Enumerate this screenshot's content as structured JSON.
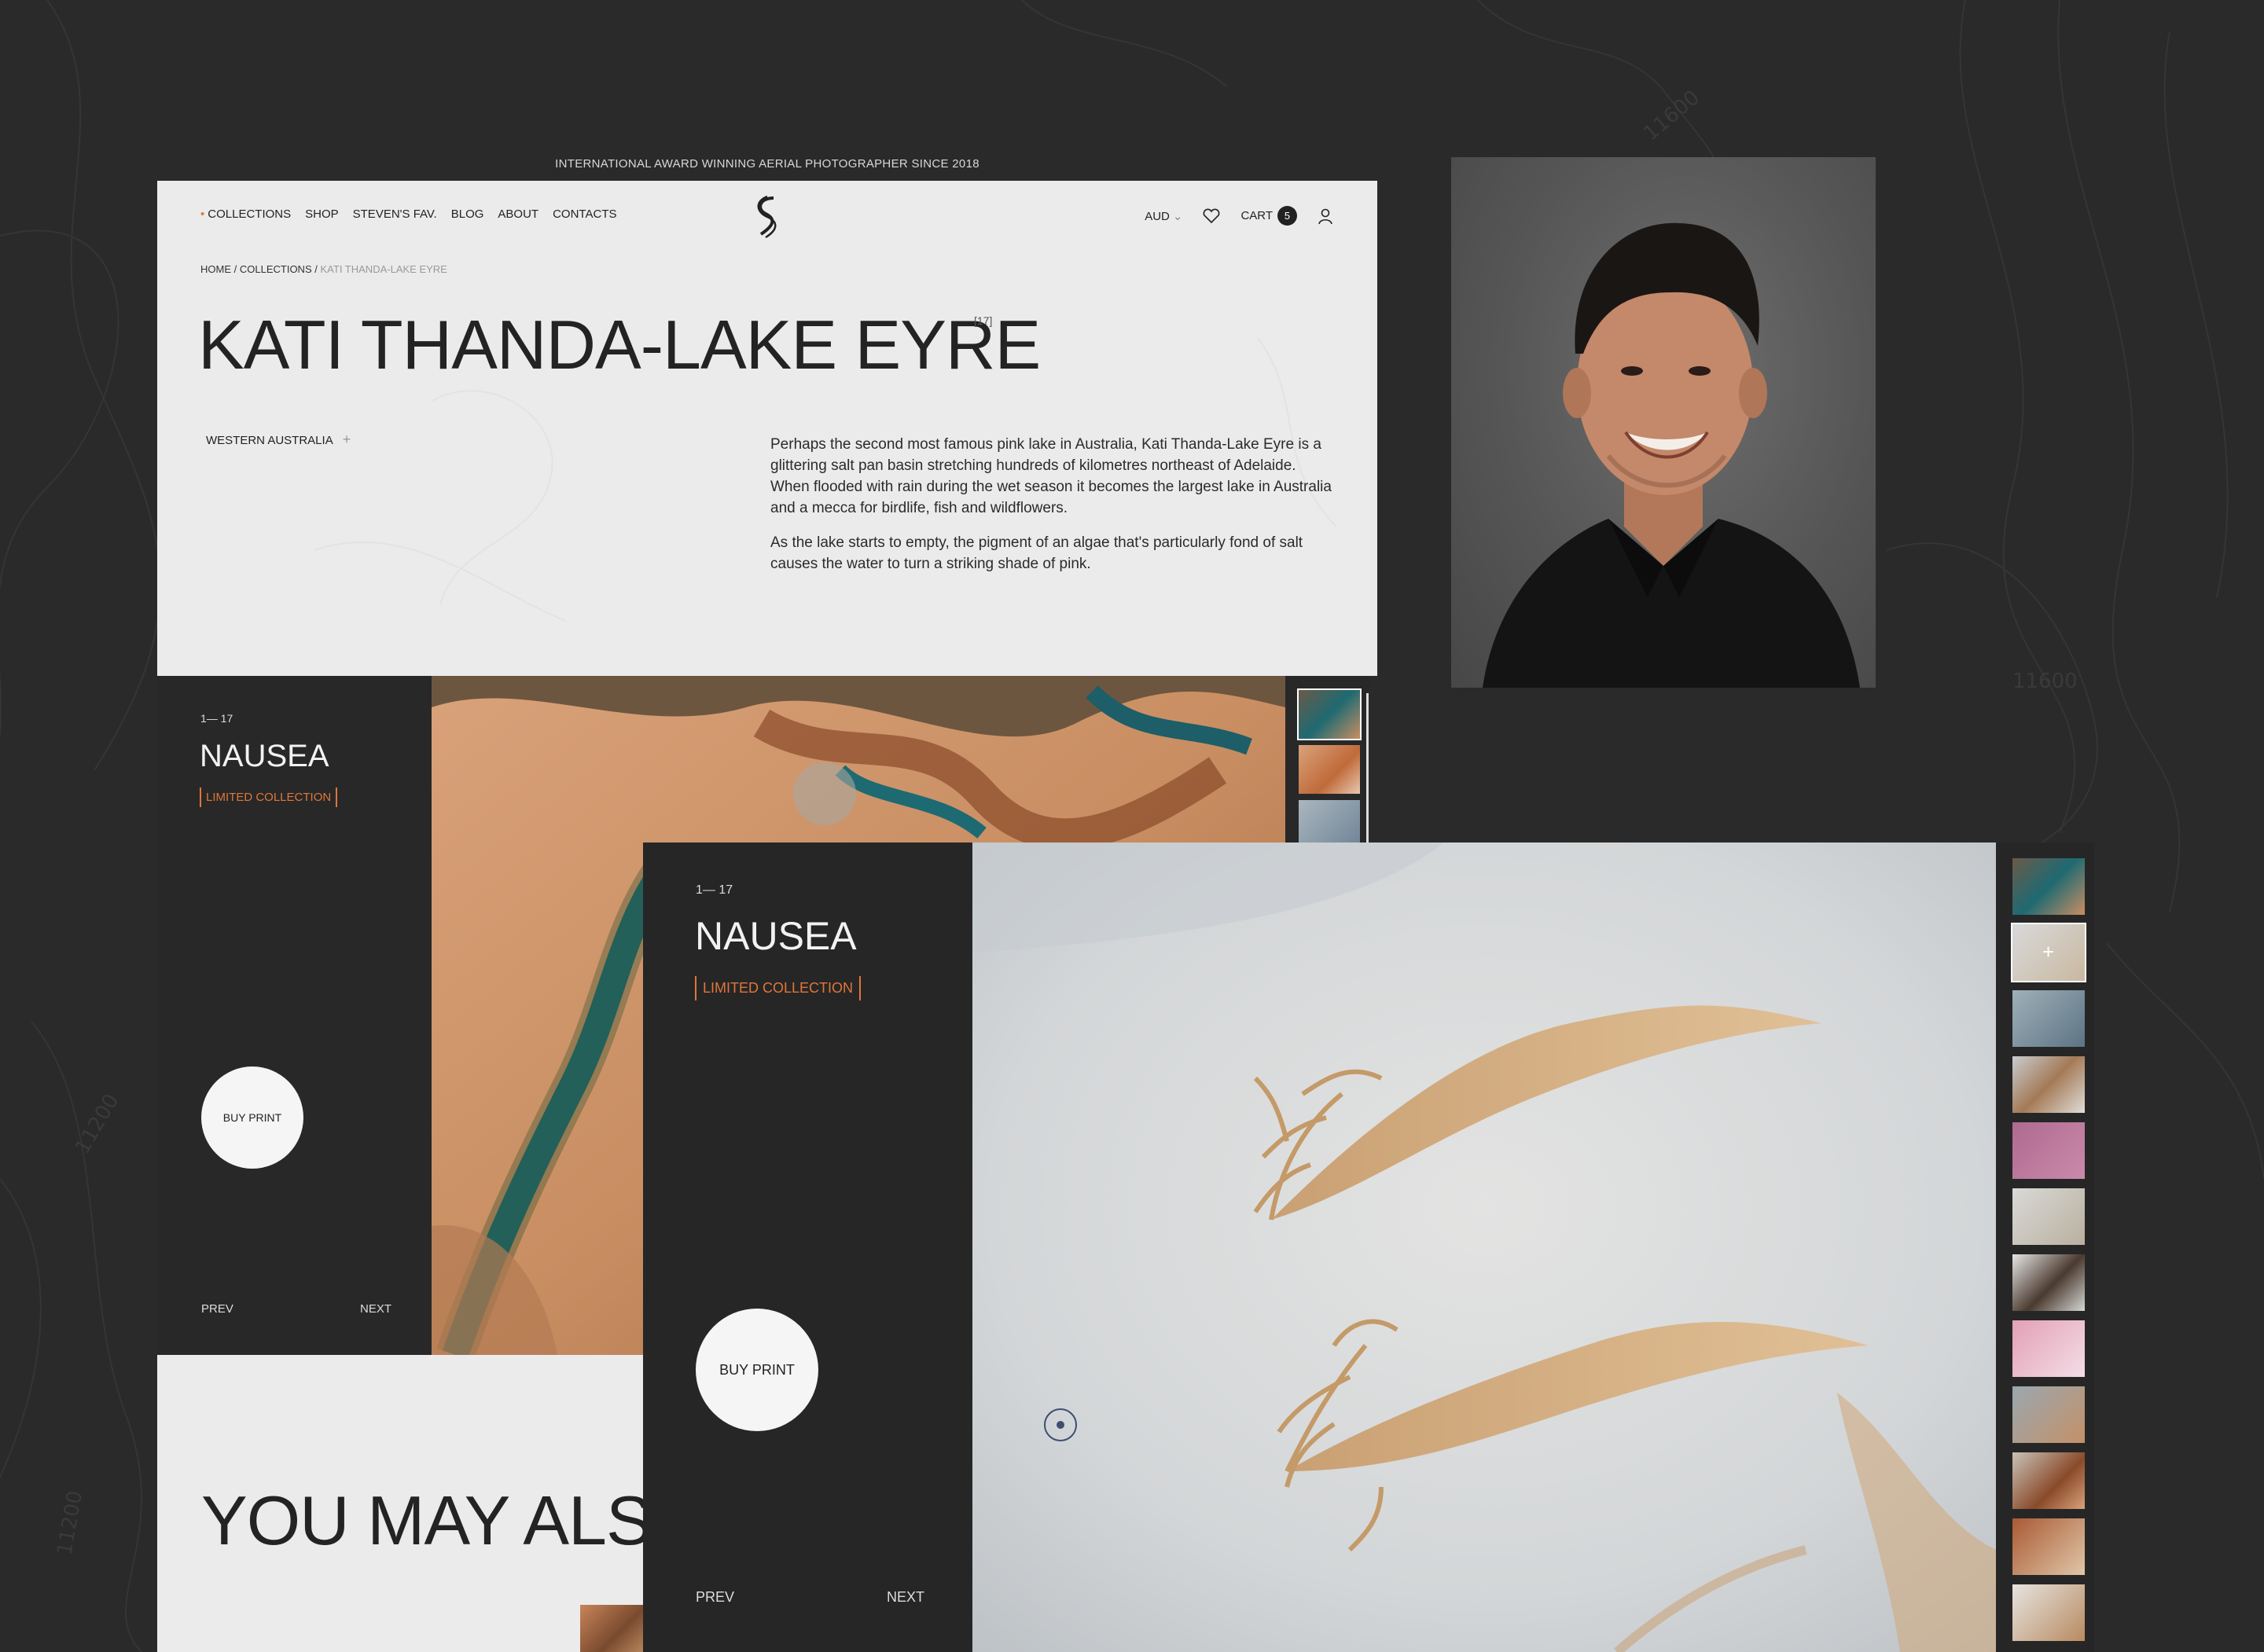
{
  "announcement": "INTERNATIONAL AWARD WINNING AERIAL PHOTOGRAPHER SINCE 2018",
  "nav": {
    "items": [
      "COLLECTIONS",
      "SHOP",
      "STEVEN'S FAV.",
      "BLOG",
      "ABOUT",
      "CONTACTS"
    ],
    "currency": "AUD",
    "cart_label": "CART",
    "cart_count": "5"
  },
  "breadcrumb": {
    "home": "HOME",
    "sep": "/",
    "collections": "COLLECTIONS",
    "current": "KATI THANDA-LAKE EYRE"
  },
  "collection": {
    "title": "KATI THANDA-LAKE EYRE",
    "count": "[17]",
    "region": "WESTERN AUSTRALIA",
    "paragraphs": [
      "Perhaps the second most famous pink lake in Australia, Kati Thanda-Lake Eyre is a glittering salt pan basin stretching hundreds of kilometres northeast of Adelaide. When flooded with rain during the wet season it becomes the largest lake in Australia and a mecca for birdlife, fish and wildflowers.",
      "As the lake starts to empty, the pigment of an algae that's particularly fond of salt causes the water to turn a striking shade of pink."
    ]
  },
  "gallery": {
    "counter": "1— 17",
    "title": "NAUSEA",
    "badge": "LIMITED COLLECTION",
    "buy_label": "BUY PRINT",
    "prev_label": "PREV",
    "next_label": "NEXT"
  },
  "related": {
    "heading": "YOU MAY ALSO"
  },
  "colors": {
    "background": "#2a2a2a",
    "panel_light": "#ebebec",
    "panel_dark": "#262626",
    "accent": "#e0763a"
  }
}
